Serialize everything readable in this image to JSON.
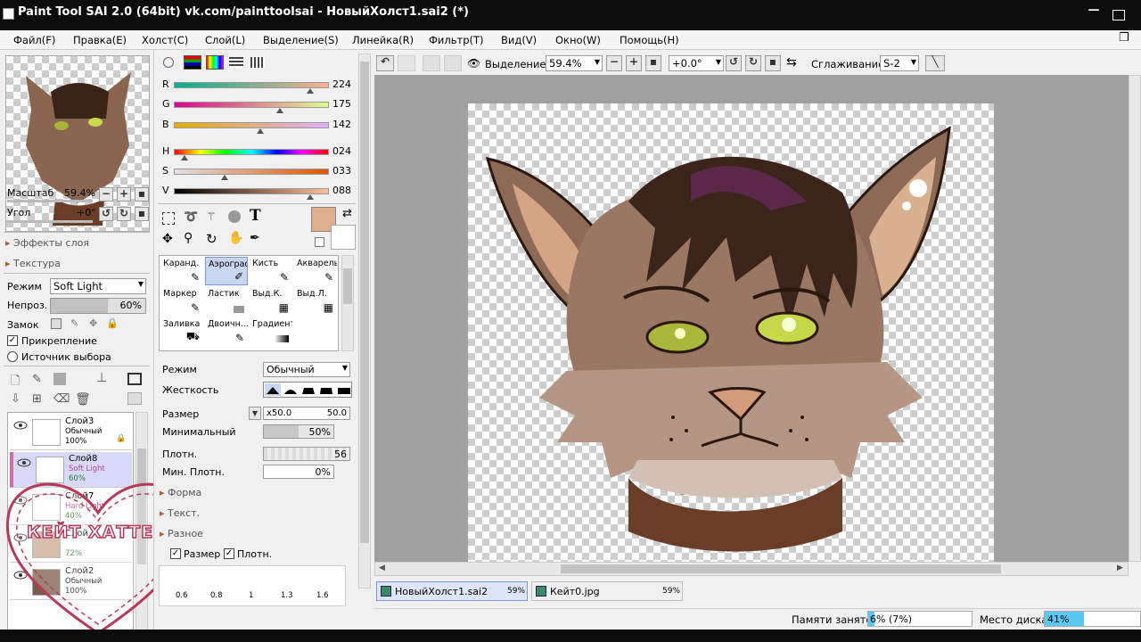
{
  "window": {
    "title": "Paint Tool SAI 2.0 (64bit) vk.com/painttoolsai - НовыйХолст1.sai2 (*)"
  },
  "menu": [
    "Файл(F)",
    "Правка(E)",
    "Холст(C)",
    "Слой(L)",
    "Выделение(S)",
    "Линейка(R)",
    "Фильтр(T)",
    "Вид(V)",
    "Окно(W)",
    "Помощь(H)"
  ],
  "navigator": {
    "zoom_label": "Масштаб",
    "zoom_value": "59.4%",
    "angle_label": "Угол",
    "angle_value": "+0°",
    "layer_effects": "Эффекты слоя",
    "texture": "Текстура"
  },
  "layer_props": {
    "mode_label": "Режим",
    "mode_value": "Soft Light",
    "opacity_label": "Непроз.",
    "opacity_value": "60%",
    "lock_label": "Замок",
    "clip_label": "Прикрепление",
    "source_label": "Источник выбора"
  },
  "layers": [
    {
      "name": "Слой3",
      "mode": "Обычный",
      "opacity": "100%"
    },
    {
      "name": "Слой8",
      "mode": "Soft Light",
      "opacity": "60%"
    },
    {
      "name": "Слой7",
      "mode": "Hard Light",
      "opacity": "40%"
    },
    {
      "name": "Слой",
      "mode": "",
      "opacity": "72%"
    },
    {
      "name": "Слой2",
      "mode": "Обычный",
      "opacity": "100%"
    }
  ],
  "watermark": {
    "text": "КЕЙТ ХАТТЕР"
  },
  "color": {
    "r_label": "R",
    "r": "224",
    "g_label": "G",
    "g": "175",
    "b_label": "B",
    "b": "142",
    "h_label": "H",
    "h": "024",
    "s_label": "S",
    "s": "033",
    "v_label": "V",
    "v": "088",
    "r_frac": 0.878,
    "g_frac": 0.686,
    "b_frac": 0.557,
    "h_frac": 0.067,
    "s_frac": 0.33,
    "v_frac": 0.88,
    "primary": "#e0af8e"
  },
  "tools": [
    [
      "Каранд.",
      "Аэрограф",
      "Кисть",
      "Акварель"
    ],
    [
      "Маркер",
      "Ластик",
      "Выд.К.",
      "Выд.Л."
    ],
    [
      "Заливка",
      "Двоичн...",
      "Градиент",
      ""
    ]
  ],
  "brush": {
    "mode_label": "Режим",
    "mode_value": "Обычный",
    "hardness_label": "Жесткость",
    "size_label": "Размер",
    "size_mult": "x50.0",
    "size_value": "50.0",
    "min_label": "Минимальный",
    "min_value": "50%",
    "density_label": "Плотн.",
    "density_value": "56",
    "min_density_label": "Мин. Плотн.",
    "min_density_value": "0%",
    "form": "Форма",
    "texture": "Текст.",
    "misc": "Разное",
    "cb_size": "Размер",
    "cb_density": "Плотн.",
    "sizes": [
      "0.6",
      "0.8",
      "1",
      "1.3",
      "1.6"
    ]
  },
  "toolbar": {
    "selection_label": "Выделение",
    "zoom": "59.4%",
    "angle": "+0.0°",
    "smoothing_label": "Сглаживание",
    "smoothing_value": "S-2"
  },
  "tabs": [
    {
      "name": "НовыйХолст1.sai2",
      "zoom": "59%"
    },
    {
      "name": "Кейт0.jpg",
      "zoom": "59%"
    }
  ],
  "status": {
    "memory_label": "Памяти занято",
    "memory_value": "6% (7%)",
    "memory_frac": 0.06,
    "disk_label": "Место диска",
    "disk_value": "41%",
    "disk_frac": 0.41
  }
}
